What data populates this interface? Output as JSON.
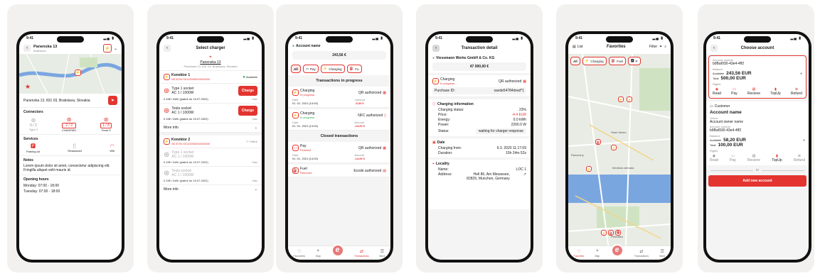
{
  "colors": {
    "accent": "#e3342f",
    "background": "#f2f1ef",
    "available": "#2eaa4a",
    "map_water": "#7aa6e0",
    "map_park": "#cfe3c2"
  },
  "status_time": "9:41",
  "s1": {
    "title": "Panenska 13",
    "subtitle": "Bratislava",
    "address": "Panenska 13, 831 03, Bratislava, Slovakia",
    "connectors_title": "Connectors",
    "connectors": [
      {
        "count": "0 / 1",
        "name": "Type 2"
      },
      {
        "count": "2 / 2",
        "name": "CHADEMO"
      },
      {
        "count": "1 / 8",
        "name": "Tesla S"
      }
    ],
    "services_title": "Services",
    "services": [
      "Parking lot",
      "Restaurant",
      "Wifi"
    ],
    "notes_title": "Notes",
    "notes": "Lorem ipsum dolor sit amet, consectetur adipiscing elit. Fringilla aliquet velit mauris id.",
    "hours_title": "Opening hours",
    "hours_1": "Monday: 07:00 - 18:00",
    "hours_2": "Tuesday: 07:00 - 18:00"
  },
  "s2": {
    "title": "Select charger",
    "location": "Panenska 13",
    "location_sub": "Panenska 13, 831 03, Bratislava, Slovakia",
    "k1_name": "Konektor 1",
    "k1_id": "SK-EVN-S0113000000000000",
    "k1_status": "Available",
    "k1_plugs": [
      {
        "name": "Type 1 socket",
        "power": "AC 1 / 1000W",
        "price": "0.15€ / kWh (platné do 15.07.2022)",
        "more": "Viac",
        "action": "Charge"
      },
      {
        "name": "Tesla socket",
        "power": "AC 1 / 1000W",
        "price": "0.15€ / kWh (platné do 15.07.2022)",
        "more": "Viac",
        "action": "Charge"
      }
    ],
    "more_info": "More info",
    "k2_name": "Konektor 2",
    "k2_id": "SK-EVN-S0113000000000000",
    "k2_status": "Offline",
    "k2_plugs": [
      {
        "name": "Type 1 socket",
        "power": "AC 1 / 1000W",
        "price": "0.15€ / kWh (platné do 15.07.2022)",
        "more": "Viac"
      },
      {
        "name": "Tesla socket",
        "power": "AC 1 / 1000W",
        "price": "0.15€ / kWh (platné do 15.07.2022)",
        "more": "Viac"
      }
    ]
  },
  "s3": {
    "account_label": "Account name",
    "balance": "243,56 €",
    "filters": [
      "All",
      "Pay",
      "Charging",
      "Fu"
    ],
    "in_progress_title": "Transactions in progress",
    "closed_title": "Closed transactions",
    "date_label": "Date",
    "amount_label": "Amount",
    "in_progress": [
      {
        "type": "Charging",
        "state": "In progress",
        "auth": "QR authorized",
        "date": "01. 01. 2021 (14:00)",
        "amount": "-5,00 €"
      },
      {
        "type": "Charging",
        "state": "In progress",
        "auth": "NFC authorized",
        "date": "01. 01. 2021 (14:00)",
        "amount": "-24,00 €"
      }
    ],
    "closed": [
      {
        "type": "Pay",
        "state": "Finished",
        "auth": "QR authorized",
        "date": "01. 01. 2021 (14:00)",
        "amount": "-14,00 €"
      },
      {
        "type": "Fuel",
        "state": "Returned",
        "auth": "Ecode authorized",
        "date": "",
        "amount": ""
      }
    ],
    "tabs": [
      "Favourites",
      "Map",
      "",
      "Transactions",
      "More"
    ]
  },
  "s4": {
    "title": "Transaction detail",
    "company": "Viessmann Werke GmbH & Co. KG",
    "total": "47 000,00 €",
    "type": "Charging",
    "type_state": "In progress",
    "auth": "QR authorized",
    "purchase_label": "Purchase ID:",
    "purchase_id": "savde54784dvsd*1",
    "info_title": "Charging information",
    "info": [
      {
        "k": "Charging status:",
        "v": "23%"
      },
      {
        "k": "Price:",
        "v": "-4.4 EUR"
      },
      {
        "k": "Energy:",
        "v": "0.0 kWh"
      },
      {
        "k": "Power:",
        "v": "2200.0 W"
      }
    ],
    "status_label": "Status:",
    "status_value": "waiting for charger response",
    "date_title": "Date",
    "from_label": "Charging from:",
    "from_value": "9.3. 2020  11:17:09",
    "duration_label": "Duration:",
    "duration_value": "15h 24m 52s",
    "locality_title": "Locality",
    "name_label": "Name:",
    "name_value": "LOC 1",
    "address_label": "Address:",
    "address_value": "Hell 86, Am Messesee, 82829, Munchen, Germany"
  },
  "s5": {
    "list_label": "List",
    "title": "Favorites",
    "filter_label": "Filter",
    "filters": [
      "All",
      "Charging",
      "Fuel",
      "P"
    ],
    "map_labels": [
      "Staré Mesto",
      "Rázsochy",
      "Medická záhrada",
      "Petržalka"
    ],
    "tabs": [
      "Favorites",
      "Map",
      "",
      "Transactions",
      "More"
    ]
  },
  "s6": {
    "title": "Choose account",
    "acc_num_label": "Account number",
    "acc_num": "b9Baf930-43e4-4ff2",
    "balance_label": "Balance",
    "available_label": "Available",
    "available": "243,56 EUR",
    "total_label": "Total",
    "total": "500,00 EUR",
    "rights_label": "Rights",
    "actions": [
      "Read",
      "Pay",
      "Recieve",
      "TopUp",
      "Refund"
    ],
    "customer_label": "Customer",
    "account_name": "Account name",
    "owner_label": "Owner",
    "owner": "Account owner name",
    "acc2_num": "b9Baf930-43e4-4ff2",
    "available2": "58,20 EUR",
    "total2": "100,00 EUR",
    "or_label": "or",
    "add_button": "Add new account"
  }
}
